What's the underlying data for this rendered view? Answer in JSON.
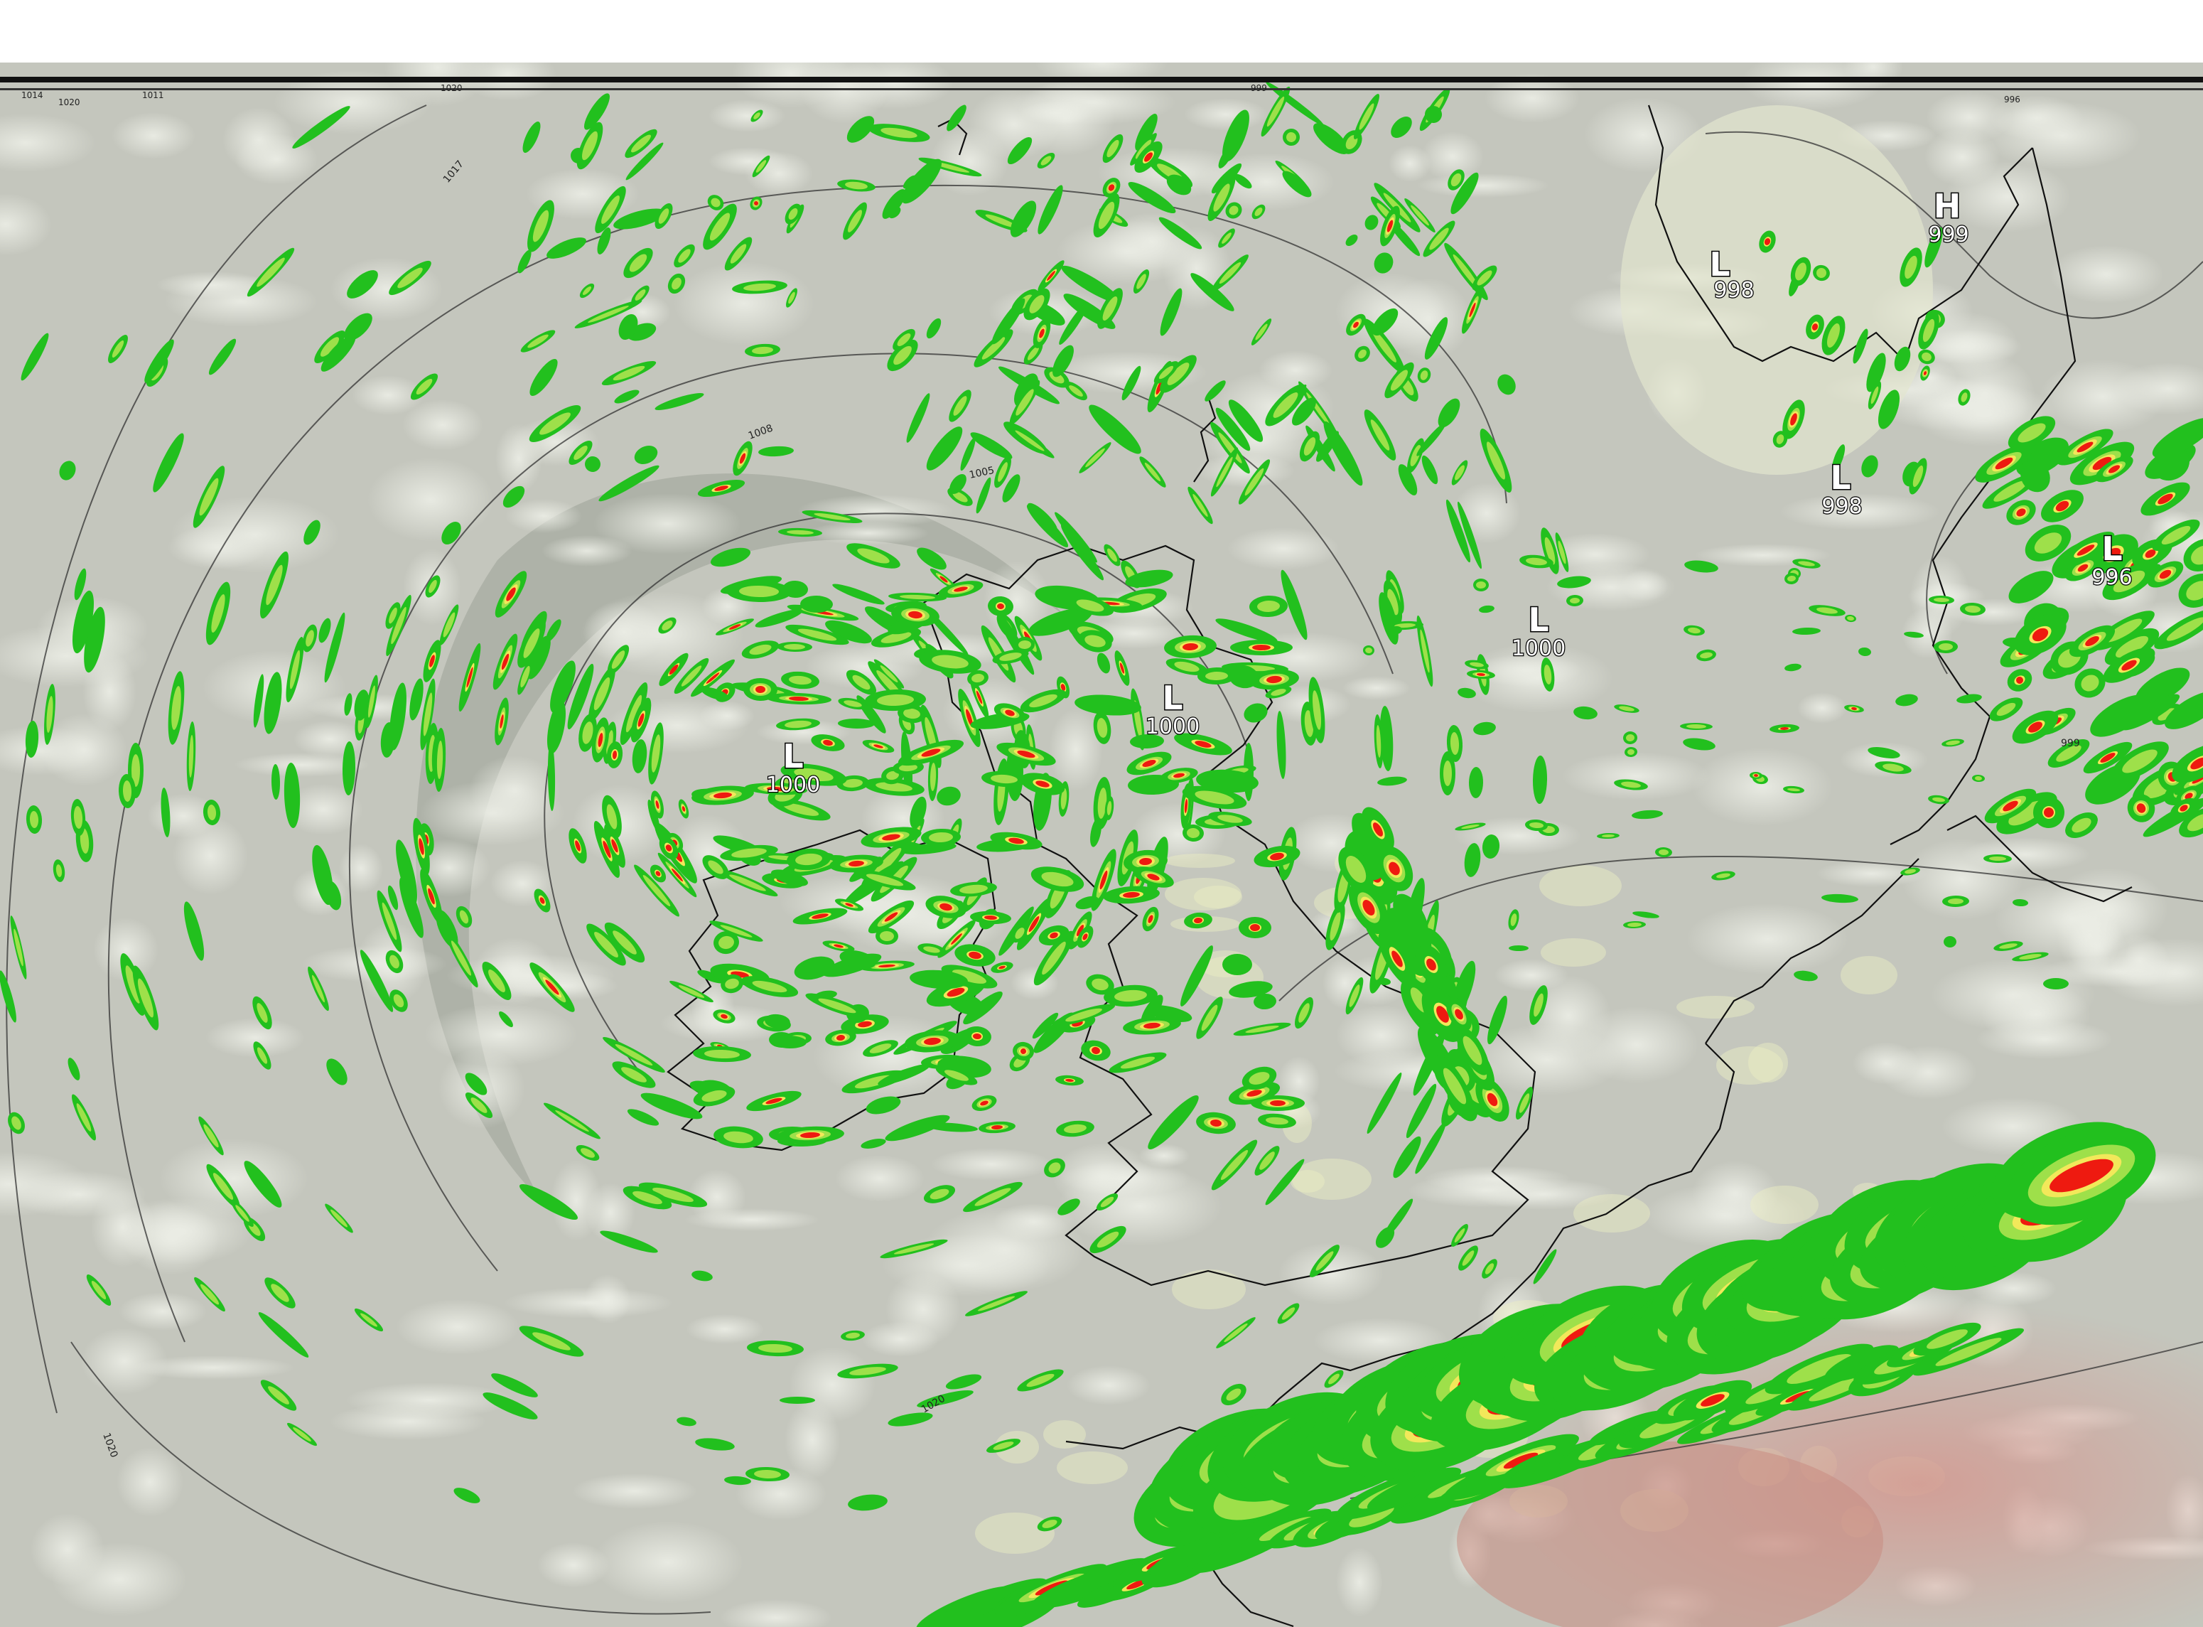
{
  "map": {
    "pressure_centers": [
      {
        "type": "L",
        "value": "998"
      },
      {
        "type": "H",
        "value": "999"
      },
      {
        "type": "L",
        "value": "998"
      },
      {
        "type": "L",
        "value": "996"
      },
      {
        "type": "L",
        "value": "1000"
      },
      {
        "type": "L",
        "value": "1000"
      },
      {
        "type": "L",
        "value": "1000"
      }
    ],
    "isobar_labels": [
      "1017",
      "1008",
      "1005",
      "1020",
      "1020",
      "999"
    ],
    "top_strip_labels": [
      "1014",
      "1020",
      "1011",
      "1020",
      "999",
      "996"
    ],
    "colors": {
      "sea_grey": "#b8bbb2",
      "cloud_white": "#e6e8df",
      "land_yellow": "#eef0c4",
      "warm_land": "#d8b4ab",
      "precip_green": "#22c01e",
      "precip_lightgreen": "#9ee04a",
      "precip_yellow": "#f2e85a",
      "precip_red": "#ee1a10",
      "coastline": "#111111",
      "isobar": "#333333"
    }
  }
}
